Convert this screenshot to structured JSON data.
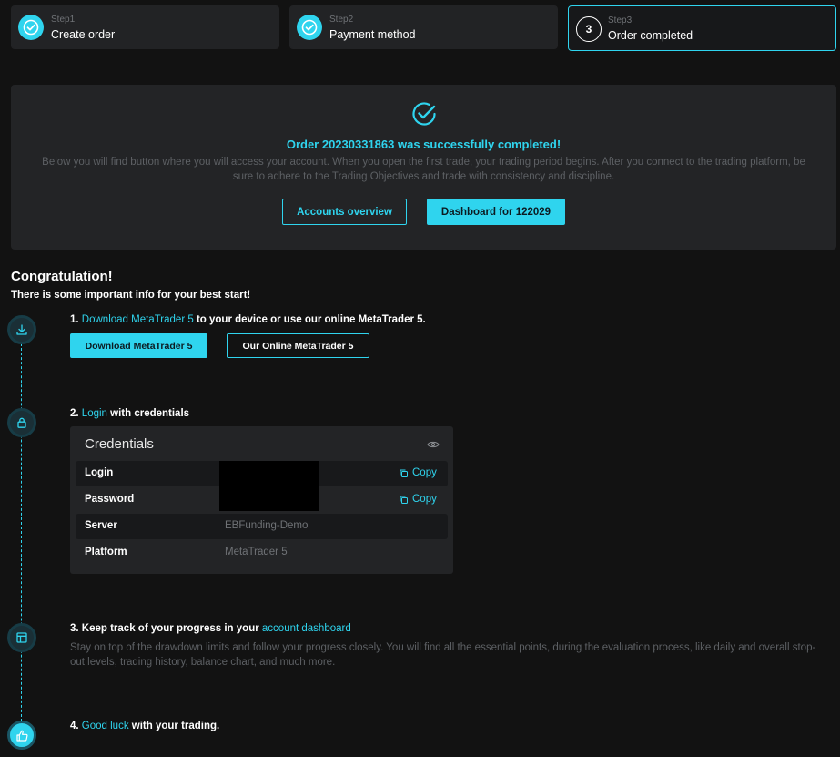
{
  "stepper": [
    {
      "step": "Step1",
      "label": "Create order",
      "state": "done"
    },
    {
      "step": "Step2",
      "label": "Payment method",
      "state": "done"
    },
    {
      "step": "Step3",
      "label": "Order completed",
      "state": "active",
      "number": "3"
    }
  ],
  "order": {
    "title": "Order 20230331863 was successfully completed!",
    "description": "Below you will find button where you will access your account. When you open the first trade, your trading period begins. After you connect to the trading platform, be sure to adhere to the Trading Objectives and trade with consistency and discipline.",
    "accounts_button": "Accounts overview",
    "dashboard_button": "Dashboard for 122029"
  },
  "congrats": {
    "title": "Congratulation!",
    "subtitle": "There is some important info for your best start!"
  },
  "steps": {
    "s1": {
      "prefix": "1. ",
      "link": "Download MetaTrader 5",
      "suffix": " to your device or use our online MetaTrader 5.",
      "download_button": "Download MetaTrader 5",
      "online_button": "Our Online MetaTrader 5"
    },
    "s2": {
      "prefix": "2. ",
      "link": "Login",
      "suffix": " with credentials"
    },
    "s3": {
      "prefix": "3. Keep track of your progress in your ",
      "link": "account dashboard",
      "description": "Stay on top of the drawdown limits and follow your progress closely. You will find all the essential points, during the evaluation process, like daily and overall stop-out levels, trading history, balance chart, and much more."
    },
    "s4": {
      "prefix": "4. ",
      "link": "Good luck",
      "suffix": " with your trading."
    }
  },
  "credentials": {
    "title": "Credentials",
    "rows": [
      {
        "key": "Login",
        "value": "",
        "copy": "Copy"
      },
      {
        "key": "Password",
        "value": "",
        "copy": "Copy"
      },
      {
        "key": "Server",
        "value": "EBFunding-Demo"
      },
      {
        "key": "Platform",
        "value": "MetaTrader 5"
      }
    ]
  },
  "colors": {
    "accent": "#2fd4ee",
    "background": "#121212",
    "panel": "#232426",
    "muted_text": "#5d6064"
  }
}
